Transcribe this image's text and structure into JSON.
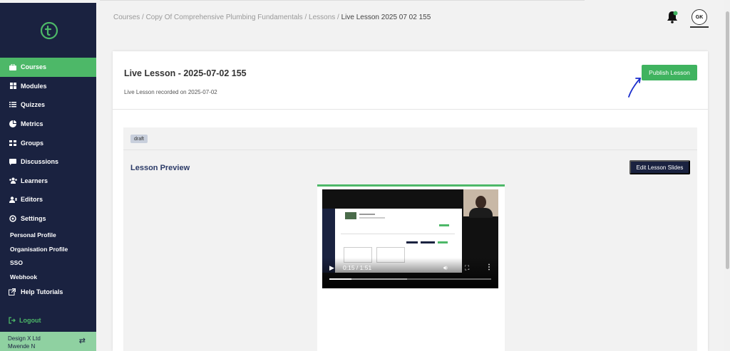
{
  "sidebar": {
    "items": [
      {
        "label": "Courses",
        "icon": "briefcase-icon",
        "active": true
      },
      {
        "label": "Modules",
        "icon": "grid-icon"
      },
      {
        "label": "Quizzes",
        "icon": "list-icon"
      },
      {
        "label": "Metrics",
        "icon": "pie-chart-icon"
      },
      {
        "label": "Groups",
        "icon": "group-grid-icon"
      },
      {
        "label": "Discussions",
        "icon": "chat-icon"
      },
      {
        "label": "Learners",
        "icon": "users-icon"
      },
      {
        "label": "Editors",
        "icon": "user-edit-icon"
      },
      {
        "label": "Settings",
        "icon": "gear-icon"
      }
    ],
    "sub_items": [
      "Personal Profile",
      "Organisation Profile",
      "SSO",
      "Webhook"
    ],
    "help": "Help Tutorials",
    "logout": "Logout",
    "org_name": "Design X Ltd",
    "user_name": "Mwende N"
  },
  "breadcrumb": {
    "trail": "Courses / Copy Of Comprehensive Plumbing Fundamentals  / Lessons / ",
    "current": "Live Lesson 2025 07 02 155"
  },
  "header": {
    "avatar_initials": "GK"
  },
  "lesson": {
    "title": "Live Lesson - 2025-07-02 155",
    "subtitle": "Live Lesson recorded on 2025-07-02",
    "publish_label": "Publish Lesson",
    "status_badge": "draft",
    "preview_title": "Lesson Preview",
    "edit_slides_label": "Edit Lesson Slides"
  },
  "video": {
    "time": "0:15 / 1:51",
    "progress": 0.135,
    "buffered": 0.48
  },
  "colors": {
    "sidebar_bg": "#1a2240",
    "accent_green": "#4db868",
    "primary_dark": "#1a2240"
  }
}
